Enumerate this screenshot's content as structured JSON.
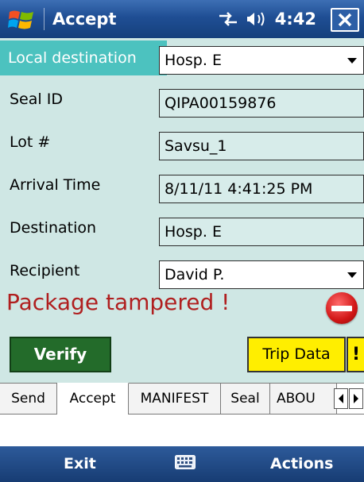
{
  "titlebar": {
    "title": "Accept",
    "time": "4:42",
    "icons": [
      "windows-flag-icon",
      "connectivity-icon",
      "speaker-icon",
      "close-icon"
    ]
  },
  "form": {
    "local_destination": {
      "label": "Local destination",
      "value": "Hosp. E"
    },
    "seal_id": {
      "label": "Seal ID",
      "value": "QIPA00159876"
    },
    "lot": {
      "label": "Lot #",
      "value": "Savsu_1"
    },
    "arrival_time": {
      "label": "Arrival Time",
      "value": "8/11/11 4:41:25 PM"
    },
    "destination": {
      "label": "Destination",
      "value": "Hosp. E"
    },
    "recipient": {
      "label": "Recipient",
      "value": "David P."
    }
  },
  "alert": {
    "text": "Package tampered !",
    "icon": "no-entry-icon",
    "color": "#b01f1f"
  },
  "actions": {
    "verify": "Verify",
    "trip_data": "Trip Data",
    "warning": "!"
  },
  "tabs": [
    "Send",
    "Accept",
    "MANIFEST",
    "Seal",
    "ABOU"
  ],
  "active_tab": "Accept",
  "softkeys": {
    "left": "Exit",
    "right": "Actions",
    "center_icon": "keyboard-icon"
  },
  "colors": {
    "highlight": "#4cc2bf",
    "verify": "#236b2a",
    "trip": "#ffee00",
    "background": "#cfe7e4"
  }
}
